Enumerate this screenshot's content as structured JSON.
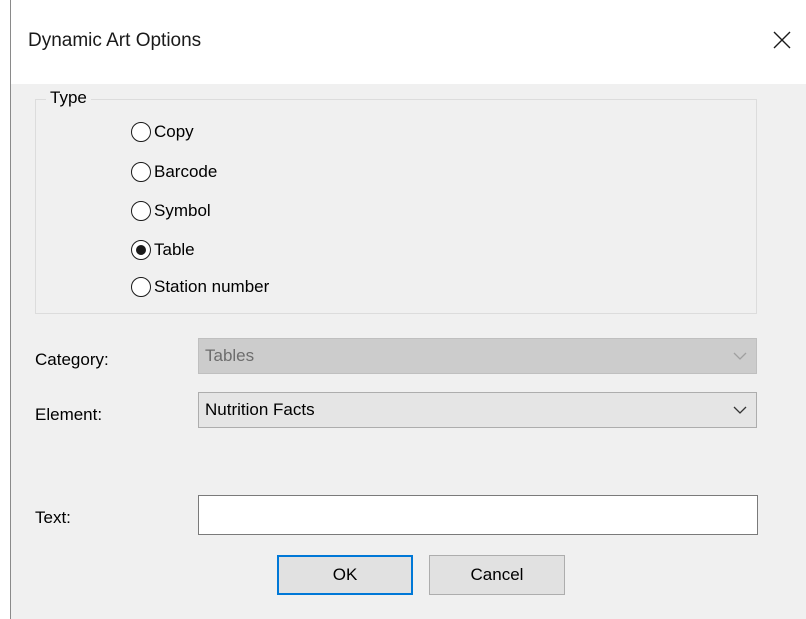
{
  "dialog": {
    "title": "Dynamic Art Options",
    "close_icon": "close-x-icon"
  },
  "type_group": {
    "label": "Type",
    "options": [
      {
        "label": "Copy",
        "selected": false
      },
      {
        "label": "Barcode",
        "selected": false
      },
      {
        "label": "Symbol",
        "selected": false
      },
      {
        "label": "Table",
        "selected": true
      },
      {
        "label": "Station number",
        "selected": false
      }
    ]
  },
  "category": {
    "label": "Category:",
    "value": "Tables",
    "enabled": false
  },
  "element": {
    "label": "Element:",
    "value": "Nutrition Facts",
    "enabled": true
  },
  "text": {
    "label": "Text:",
    "value": ""
  },
  "buttons": {
    "ok": "OK",
    "cancel": "Cancel"
  },
  "colors": {
    "dialog_bg": "#f0f0f0",
    "accent": "#0078d7"
  }
}
